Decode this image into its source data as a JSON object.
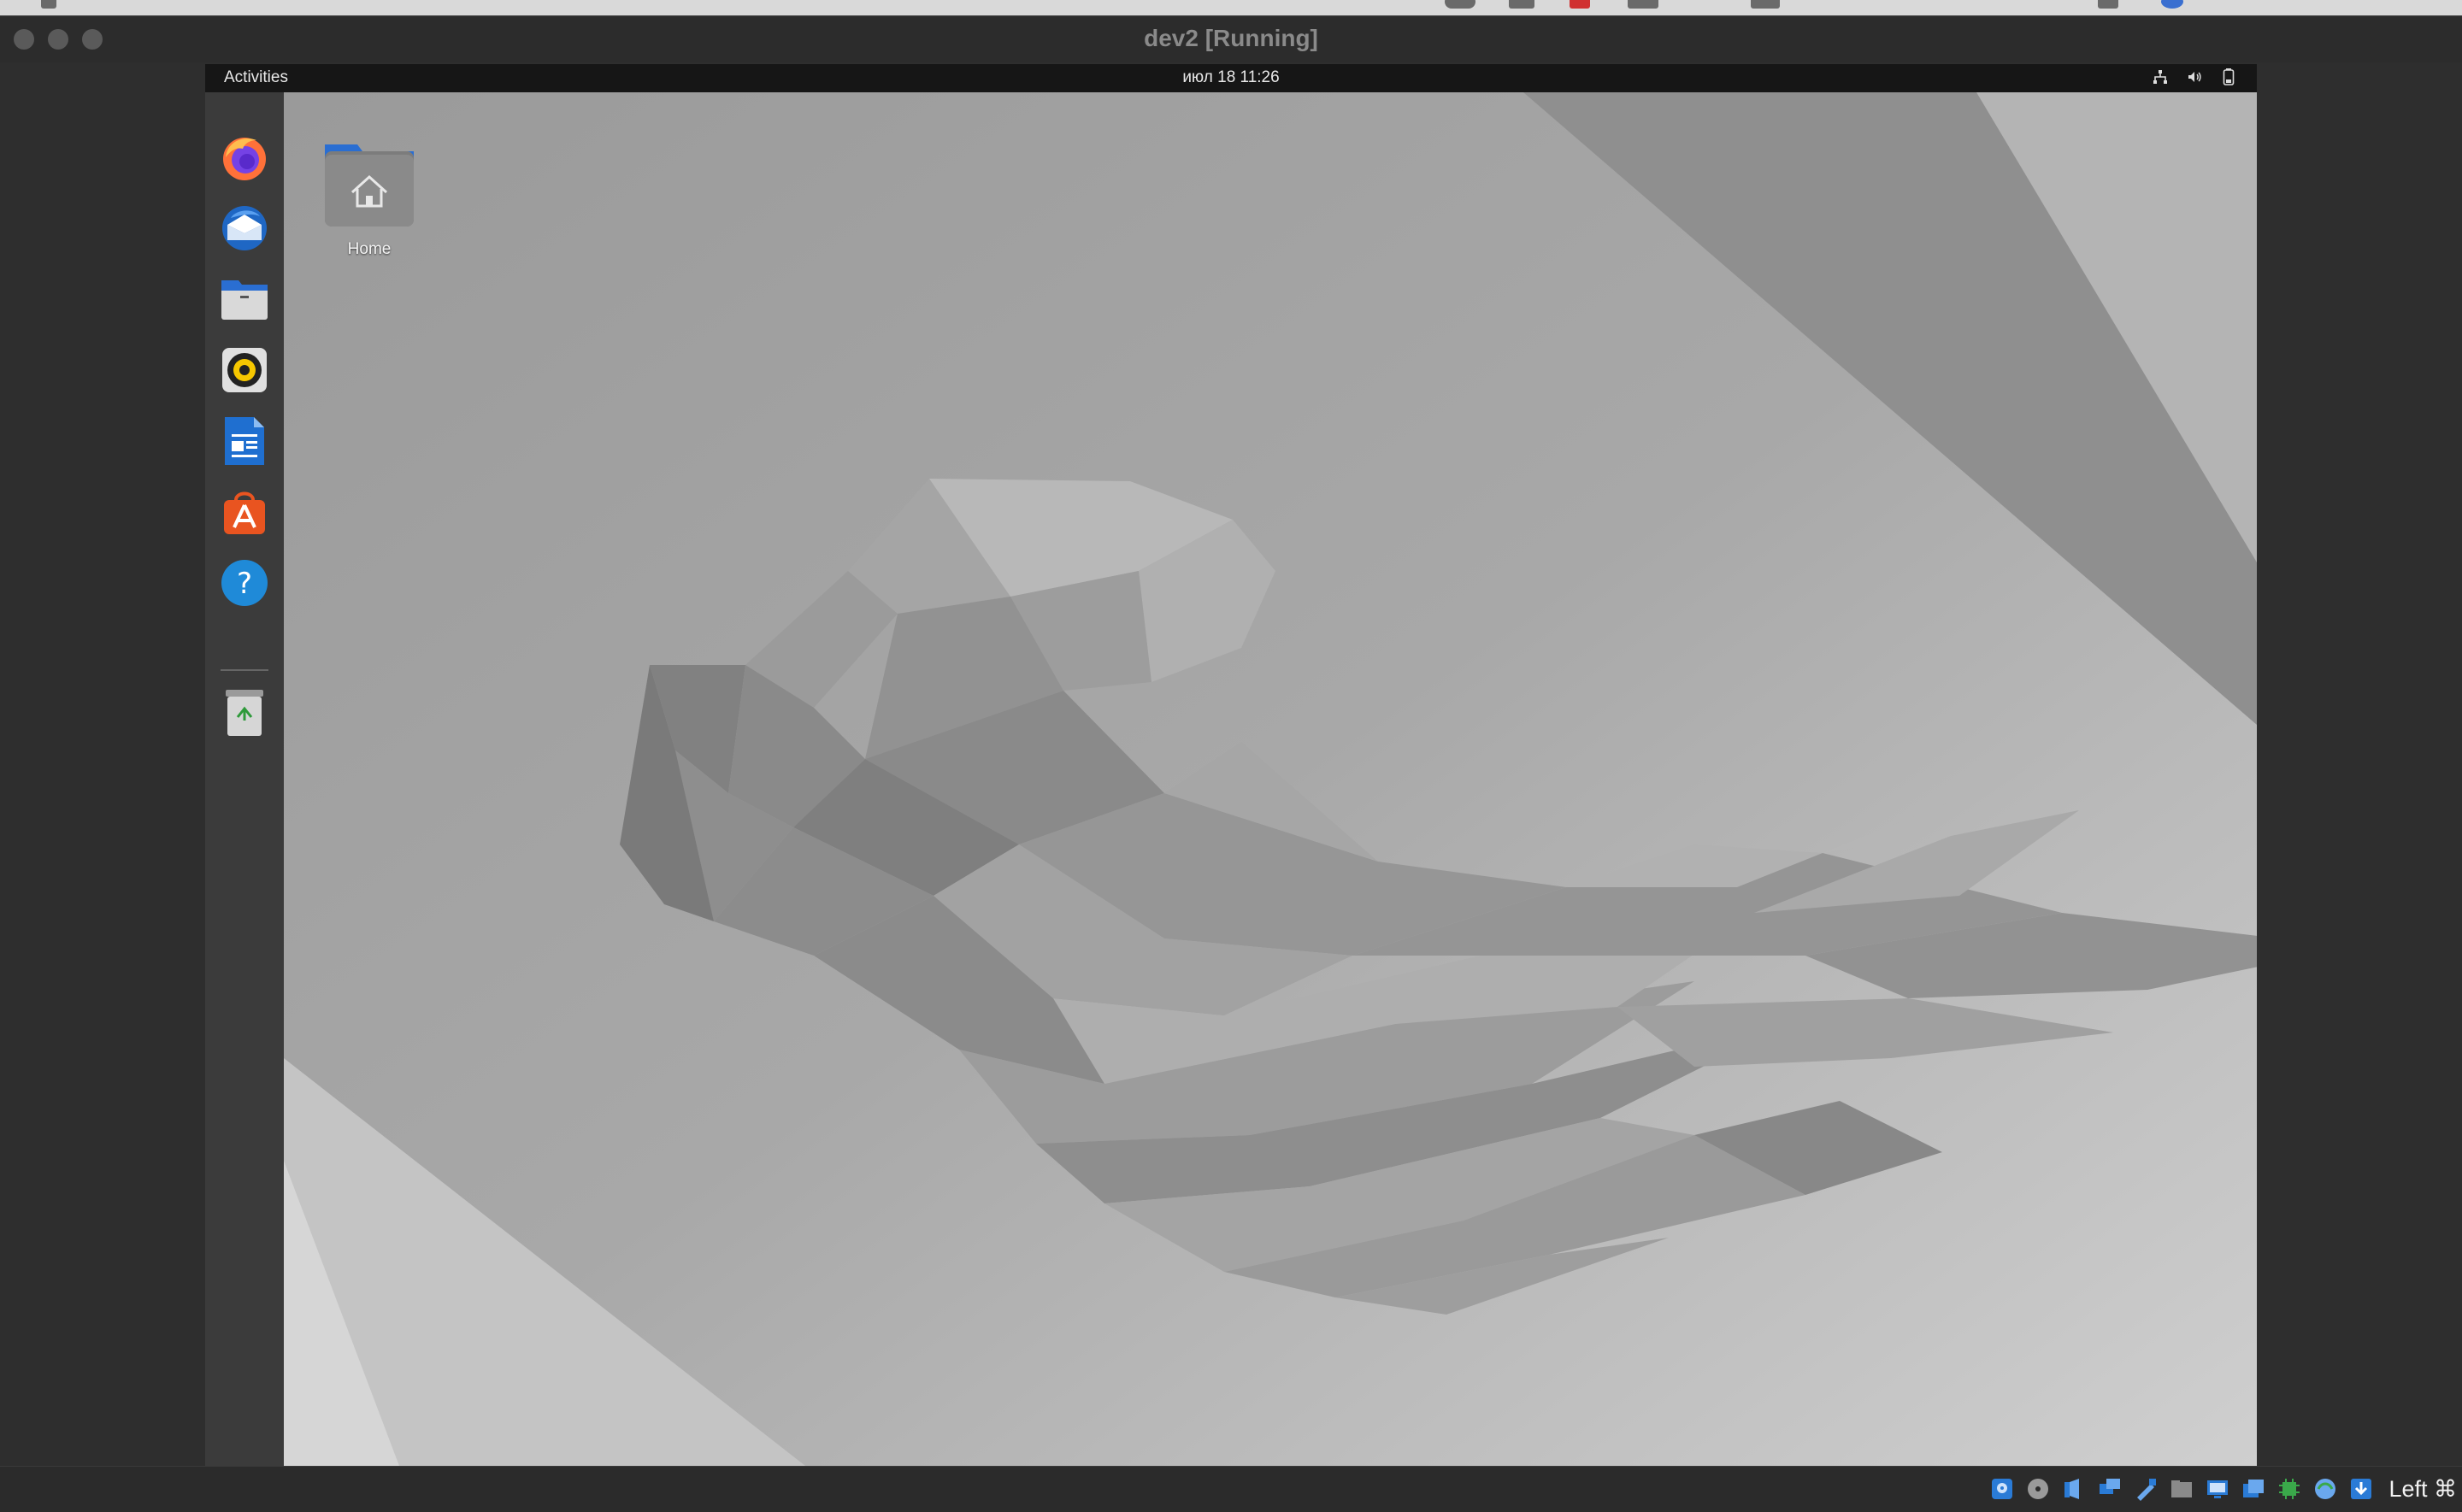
{
  "window": {
    "title": "dev2 [Running]"
  },
  "guest": {
    "topbar": {
      "activities": "Activities",
      "clock": "июл 18  11:26",
      "tray": [
        "network-icon",
        "volume-icon",
        "battery-icon"
      ]
    },
    "dock": {
      "items": [
        {
          "name": "firefox",
          "icon": "firefox-icon"
        },
        {
          "name": "thunderbird",
          "icon": "thunderbird-icon"
        },
        {
          "name": "files",
          "icon": "files-icon"
        },
        {
          "name": "rhythmbox",
          "icon": "rhythmbox-icon"
        },
        {
          "name": "libreoffice-writer",
          "icon": "writer-icon"
        },
        {
          "name": "ubuntu-software",
          "icon": "software-icon"
        },
        {
          "name": "help",
          "icon": "help-icon"
        },
        {
          "name": "trash",
          "icon": "trash-icon"
        }
      ]
    },
    "desktop": {
      "home_label": "Home"
    }
  },
  "statusbar": {
    "icons": [
      "hard-disk-icon",
      "optical-drive-icon",
      "audio-icon",
      "network-icon",
      "usb-icon",
      "shared-folders-icon",
      "display-icon",
      "video-capture-icon",
      "mouse-integration-icon",
      "cpu-icon",
      "vm-state-icon",
      "download-icon"
    ],
    "host_key": "Left ⌘"
  },
  "colors": {
    "dock_bg": "#3b3b3b",
    "topbar_bg": "#161616",
    "firefox": "#ff7139",
    "software_orange": "#e95420",
    "help_blue": "#1f8ad8",
    "folder_blue": "#2a6ed2"
  }
}
